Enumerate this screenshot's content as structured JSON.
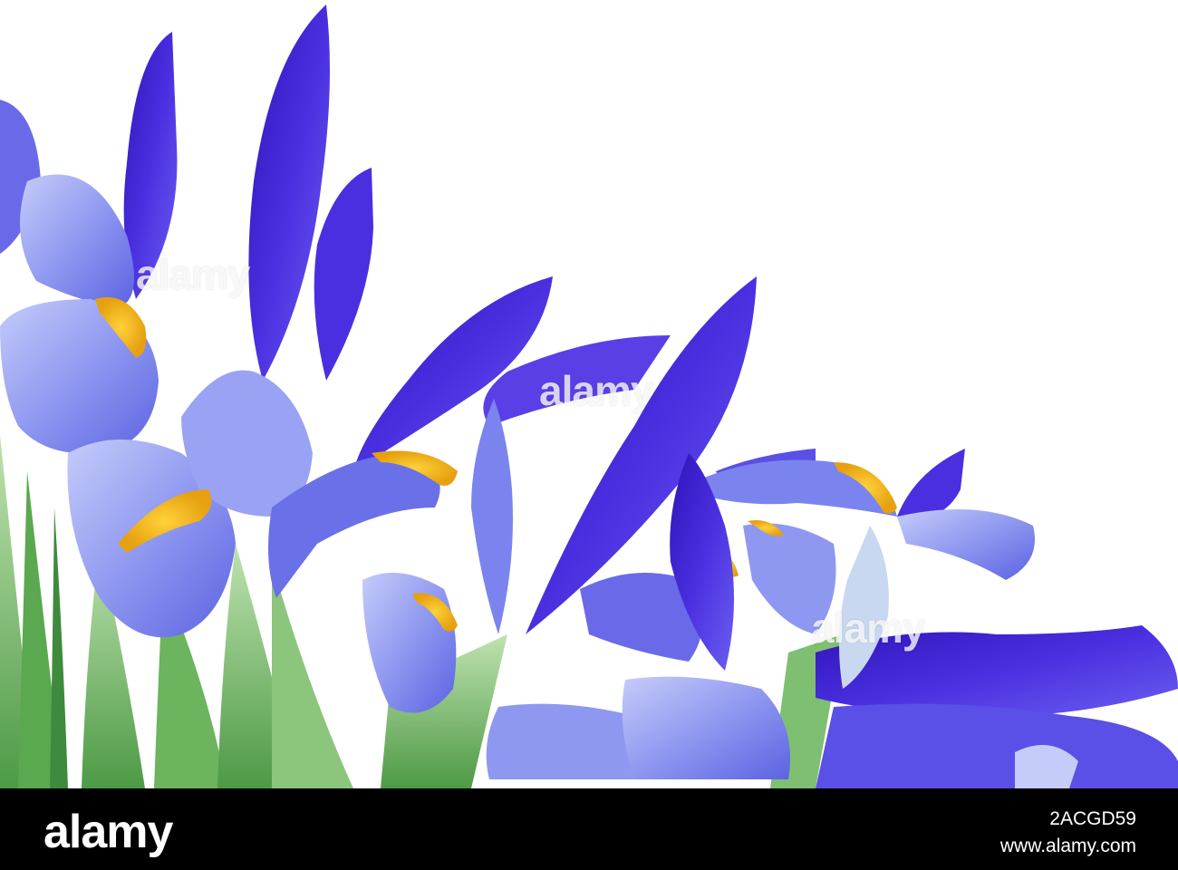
{
  "photo": {
    "subject": "blue-iris-flowers",
    "background_color": "#ffffff",
    "colors": {
      "petal_deep": "#3b1fd0",
      "petal_mid": "#5a4fe6",
      "petal_light": "#8f98f0",
      "petal_pale": "#b7c0f7",
      "signal_yellow": "#f0b51c",
      "leaf_dark": "#3f8a3c",
      "leaf_light": "#a9d39c"
    },
    "watermarks": [
      "alamy",
      "alamy",
      "alamy"
    ]
  },
  "footer": {
    "logo_text": "alamy",
    "image_id": "2ACGD59",
    "url": "www.alamy.com"
  }
}
